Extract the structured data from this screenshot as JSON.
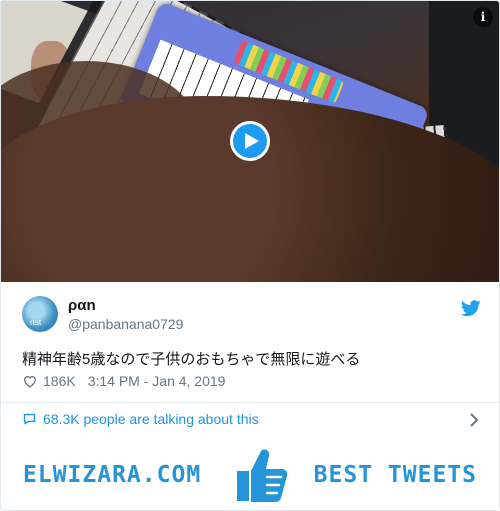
{
  "media": {
    "info_icon_label": "i",
    "play_icon": "play-icon"
  },
  "tweet": {
    "display_name": "ραn",
    "handle": "@panbanana0729",
    "avatar_text": "rtst",
    "text": "精神年齢5歳なので子供のおもちゃで無限に遊べる",
    "likes": "186K",
    "timestamp": "3:14 PM - Jan 4, 2019",
    "talking": "68.3K people are talking about this"
  },
  "banner": {
    "left_text": "ELWIZARA.COM",
    "right_text": "BEST TWEETS"
  },
  "colors": {
    "twitter_blue": "#1da1f2",
    "link_blue": "#1b95e0",
    "banner_blue": "#2694d8",
    "text_dark": "#14171a",
    "text_gray": "#657786"
  }
}
